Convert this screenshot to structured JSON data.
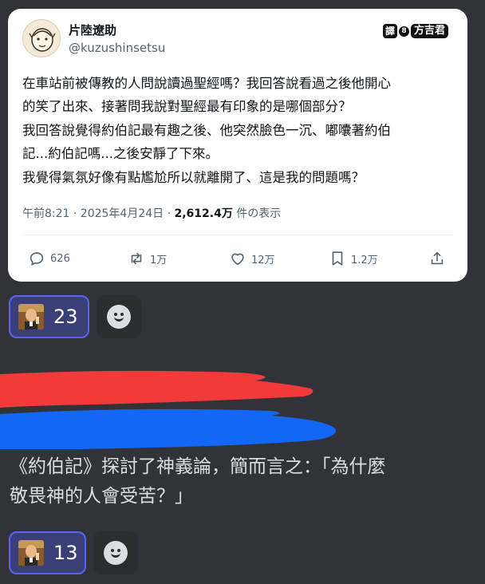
{
  "tweet": {
    "display_name": "片陸遼助",
    "handle": "@kuzushinsetsu",
    "watermark": {
      "box": "譯",
      "number": "8",
      "name": "方吉君"
    },
    "text_lines": [
      "在車站前被傳教的人問說讀過聖經嗎？我回答說看過之後他開心",
      "的笑了出來、接著問我說對聖經最有印象的是哪個部分？",
      "我回答說覺得約伯記最有趣之後、他突然臉色一沉、嘟囔著約伯",
      "記...約伯記嗎...之後安靜了下來。",
      "我覺得氣氛好像有點尷尬所以就離開了、這是我的問題嗎？"
    ],
    "timestamp": "午前8:21 · 2025年4月24日 ·",
    "views": "2,612.4万",
    "views_suffix": "件の表示",
    "replies": "626",
    "retweets": "1万",
    "likes": "12万",
    "bookmarks": "1.2万"
  },
  "reactions": [
    {
      "emoji": "leo-toast-emoji",
      "count": "23"
    },
    {
      "emoji": "leo-toast-emoji",
      "count": "13"
    }
  ],
  "message": {
    "lines": [
      "《約伯記》探討了神義論，簡而言之：「為什麼",
      "敬畏神的人會受苦？」"
    ]
  },
  "colors": {
    "background": "#313338",
    "card": "#ffffff",
    "reaction_active": "#3b3f78",
    "reaction_border": "#5865f2",
    "redact_red": "#f23a3a",
    "redact_blue": "#1466f5"
  }
}
